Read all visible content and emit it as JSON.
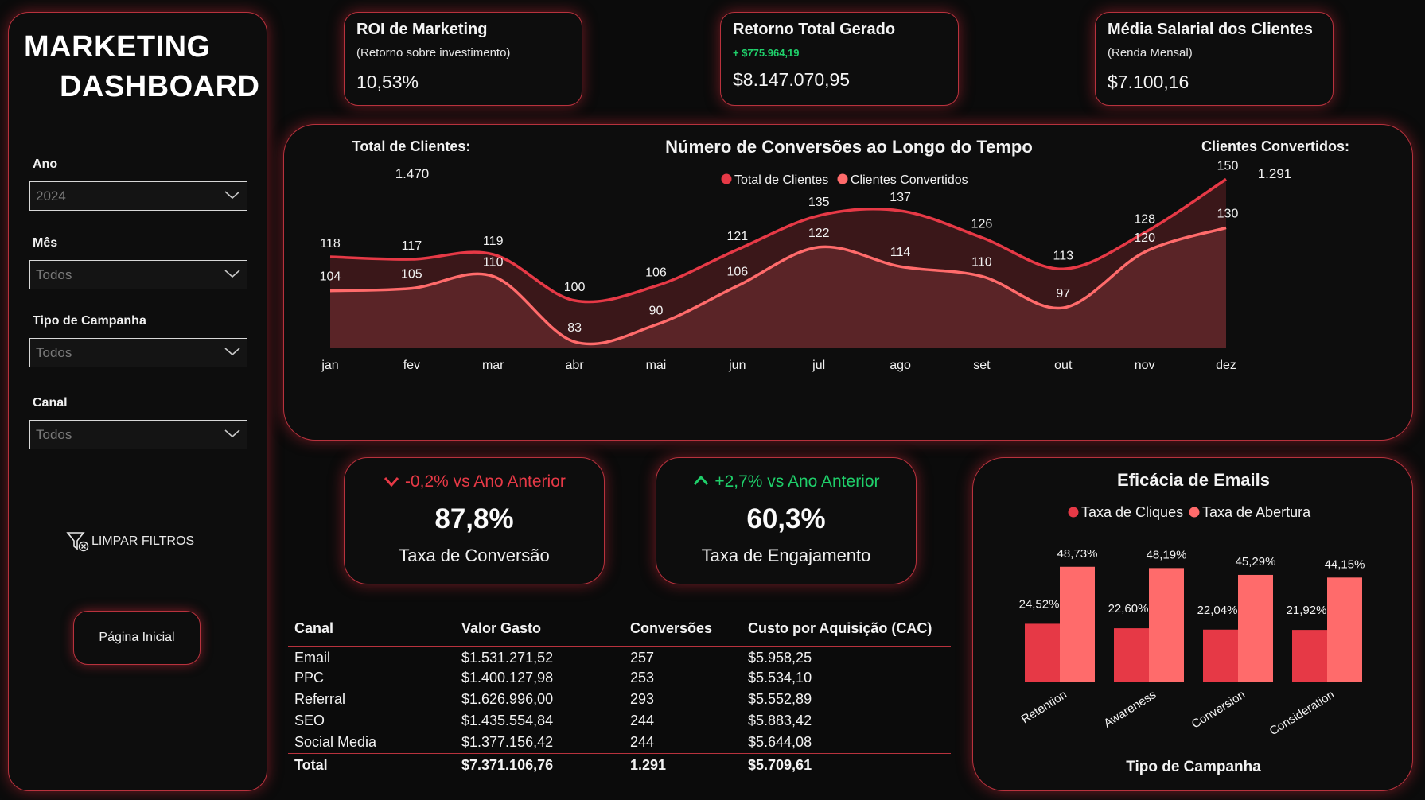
{
  "sidebar": {
    "title_line1": "MARKETING",
    "title_line2": "DASHBOARD",
    "filters": [
      {
        "label": "Ano",
        "value": "2024"
      },
      {
        "label": "Mês",
        "value": "Todos"
      },
      {
        "label": "Tipo de Campanha",
        "value": "Todos"
      },
      {
        "label": "Canal",
        "value": "Todos"
      }
    ],
    "clear_filters_label": "LIMPAR FILTROS",
    "home_button_label": "Página Inicial"
  },
  "kpis": {
    "roi": {
      "title": "ROI de Marketing",
      "subtitle": "(Retorno sobre investimento)",
      "value": "10,53%"
    },
    "retorno": {
      "title": "Retorno Total Gerado",
      "delta": "+ $775.964,19",
      "value": "$8.147.070,95"
    },
    "salario": {
      "title": "Média Salarial dos Clientes",
      "subtitle": "(Renda Mensal)",
      "value": "$7.100,16"
    }
  },
  "line_chart": {
    "title": "Número de Conversões ao Longo do Tempo",
    "total_clientes_label": "Total de Clientes:",
    "total_clientes_value": "1.470",
    "clientes_convertidos_label": "Clientes Convertidos:",
    "clientes_convertidos_value": "1.291",
    "colors": {
      "total": "#e63946",
      "convertidos": "#ff6b6b",
      "fill": "#4a1c1e"
    }
  },
  "chart_data": [
    {
      "type": "area",
      "title": "Número de Conversões ao Longo do Tempo",
      "categories": [
        "jan",
        "fev",
        "mar",
        "abr",
        "mai",
        "jun",
        "jul",
        "ago",
        "set",
        "out",
        "nov",
        "dez"
      ],
      "series": [
        {
          "name": "Total de Clientes",
          "values": [
            118,
            117,
            119,
            100,
            106,
            121,
            135,
            137,
            126,
            113,
            128,
            150
          ]
        },
        {
          "name": "Clientes Convertidos",
          "values": [
            104,
            105,
            110,
            83,
            90,
            106,
            122,
            114,
            110,
            97,
            120,
            130
          ]
        }
      ],
      "legend": "top-center",
      "grid": false
    },
    {
      "type": "bar",
      "title": "Eficácia de Emails",
      "xlabel": "Tipo de Campanha",
      "categories": [
        "Retention",
        "Awareness",
        "Conversion",
        "Consideration"
      ],
      "series": [
        {
          "name": "Taxa de Cliques",
          "values": [
            24.52,
            22.6,
            22.04,
            21.92
          ],
          "labels": [
            "24,52%",
            "22,60%",
            "22,04%",
            "21,92%"
          ],
          "color": "#e63946"
        },
        {
          "name": "Taxa de Abertura",
          "values": [
            48.73,
            48.19,
            45.29,
            44.15
          ],
          "labels": [
            "48,73%",
            "48,19%",
            "45,29%",
            "44,15%"
          ],
          "color": "#ff6b6b"
        }
      ],
      "legend": "top-center",
      "grid": false
    }
  ],
  "rates": {
    "conversao": {
      "delta": "-0,2% vs Ano Anterior",
      "value": "87,8%",
      "name": "Taxa de Conversão",
      "delta_color": "#e63946"
    },
    "engajamento": {
      "delta": "+2,7% vs Ano Anterior",
      "value": "60,3%",
      "name": "Taxa de Engajamento",
      "delta_color": "#1fcf6a"
    }
  },
  "table": {
    "headers": [
      "Canal",
      "Valor Gasto",
      "Conversões",
      "Custo por Aquisição (CAC)"
    ],
    "rows": [
      [
        "Email",
        "$1.531.271,52",
        "257",
        "$5.958,25"
      ],
      [
        "PPC",
        "$1.400.127,98",
        "253",
        "$5.534,10"
      ],
      [
        "Referral",
        "$1.626.996,00",
        "293",
        "$5.552,89"
      ],
      [
        "SEO",
        "$1.435.554,84",
        "244",
        "$5.883,42"
      ],
      [
        "Social Media",
        "$1.377.156,42",
        "244",
        "$5.644,08"
      ]
    ],
    "total": [
      "Total",
      "$7.371.106,76",
      "1.291",
      "$5.709,61"
    ]
  }
}
